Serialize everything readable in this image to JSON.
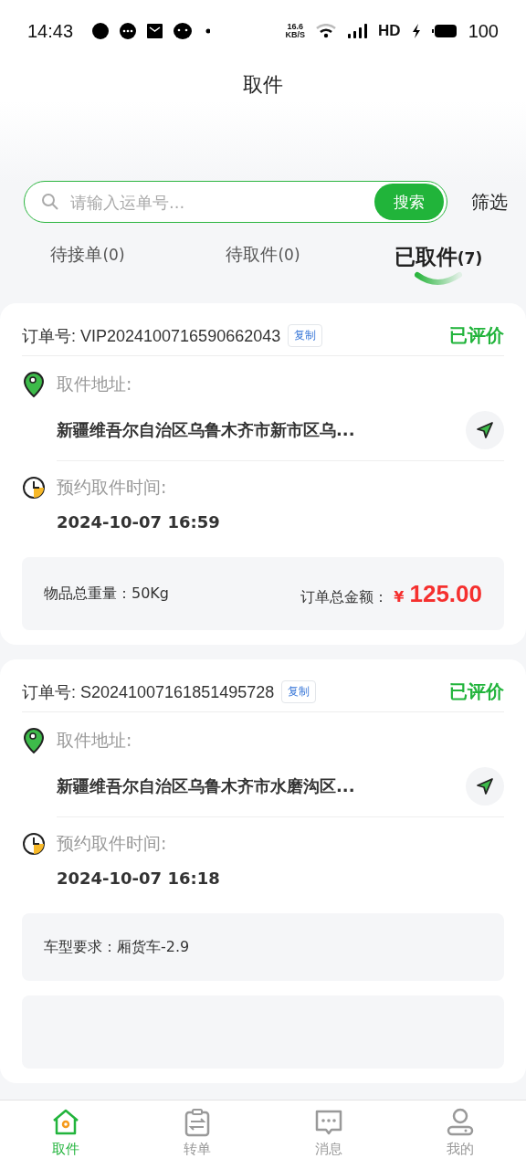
{
  "status_bar": {
    "time": "14:43",
    "speed_value": "16.6",
    "speed_unit": "KB/S",
    "hd": "HD",
    "battery": "100"
  },
  "header": {
    "title": "取件"
  },
  "search": {
    "placeholder": "请输入运单号...",
    "button": "搜索",
    "filter": "筛选"
  },
  "tabs": [
    {
      "label": "待接单",
      "count": "(0)",
      "selected": false
    },
    {
      "label": "待取件",
      "count": "(0)",
      "selected": false
    },
    {
      "label": "已取件",
      "count": "(7)",
      "selected": true
    }
  ],
  "orders": [
    {
      "order_no": "订单号: VIP2024100716590662043",
      "copy": "复制",
      "status": "已评价",
      "address_label": "取件地址:",
      "address": "新疆维吾尔自治区乌鲁木齐市新市区乌...",
      "time_label": "预约取件时间:",
      "time": "2024-10-07 16:59",
      "details": [
        {
          "kind": "summary",
          "weight": "物品总重量：50Kg",
          "amount_label": "订单总金额：",
          "currency": "¥",
          "amount": "125.00"
        }
      ]
    },
    {
      "order_no": "订单号: S20241007161851495728",
      "copy": "复制",
      "status": "已评价",
      "address_label": "取件地址:",
      "address": "新疆维吾尔自治区乌鲁木齐市水磨沟区...",
      "time_label": "预约取件时间:",
      "time": "2024-10-07 16:18",
      "details": [
        {
          "kind": "vehicle",
          "text": "车型要求：厢货车-2.9"
        },
        {
          "kind": "covered"
        }
      ]
    }
  ],
  "bottom_nav": [
    {
      "label": "取件",
      "selected": true
    },
    {
      "label": "转单",
      "selected": false
    },
    {
      "label": "消息",
      "selected": false
    },
    {
      "label": "我的",
      "selected": false
    }
  ]
}
